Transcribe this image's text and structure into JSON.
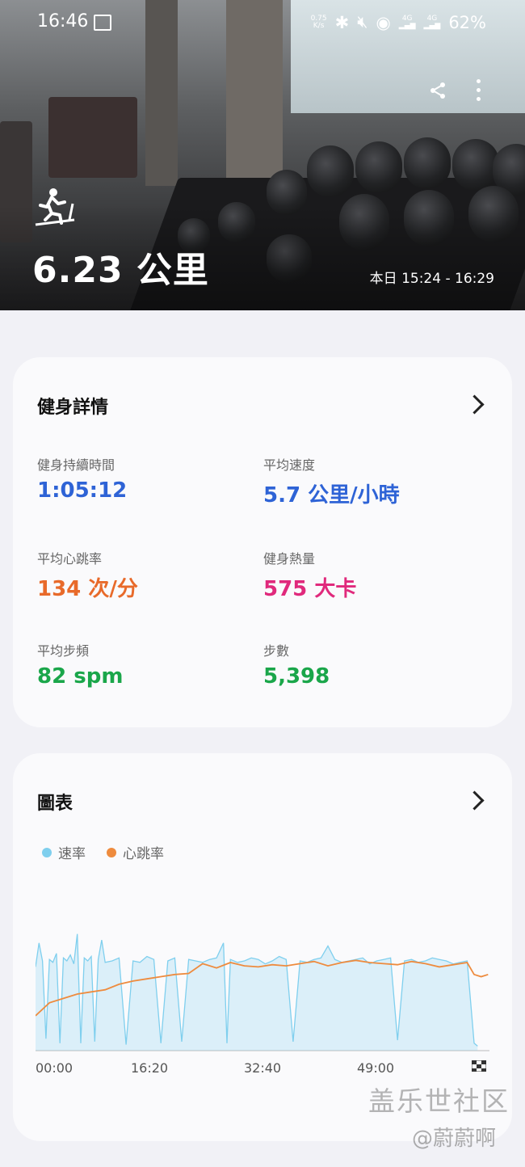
{
  "status_bar": {
    "time": "16:46",
    "net_speed_top": "0.75",
    "net_speed_bottom": "K/s",
    "signal1": "4G",
    "signal2": "4G",
    "battery": "62%"
  },
  "hero": {
    "distance": "6.23 公里",
    "time_range": "本日 15:24 - 16:29"
  },
  "details": {
    "title": "健身詳情",
    "metrics": [
      {
        "label": "健身持續時間",
        "value": "1:05:12",
        "color": "#2e63d6"
      },
      {
        "label": "平均速度",
        "value": "5.7 公里/小時",
        "color": "#2e63d6"
      },
      {
        "label": "平均心跳率",
        "value": "134 次/分",
        "color": "#e86a2a"
      },
      {
        "label": "健身熱量",
        "value": "575 大卡",
        "color": "#e0297c"
      },
      {
        "label": "平均步頻",
        "value": "82 spm",
        "color": "#1aa64a"
      },
      {
        "label": "步數",
        "value": "5,398",
        "color": "#1aa64a"
      }
    ]
  },
  "chart_card": {
    "title": "圖表",
    "legend": [
      {
        "label": "速率",
        "color": "#7fcfee"
      },
      {
        "label": "心跳率",
        "color": "#ee8b3e"
      }
    ],
    "x_ticks": [
      "00:00",
      "16:20",
      "32:40",
      "49:00"
    ]
  },
  "watermark": {
    "line1": "盖乐世社区",
    "line2": "@蔚蔚啊"
  },
  "chart_data": {
    "type": "line",
    "x_unit": "minutes",
    "xlim": [
      0,
      65.2
    ],
    "x_ticks": [
      "00:00",
      "16:20",
      "32:40",
      "49:00"
    ],
    "series": [
      {
        "name": "速率",
        "color": "#7fcfee",
        "fill": true,
        "x": [
          0,
          0.5,
          1,
          1.5,
          2,
          2.5,
          3,
          3.5,
          4,
          4.5,
          5,
          5.5,
          6,
          6.5,
          7,
          7.5,
          8,
          8.5,
          9,
          9.5,
          10,
          11,
          12,
          13,
          14,
          15,
          16,
          17,
          18,
          19,
          20,
          21,
          22,
          23,
          24,
          25,
          26,
          27,
          27.5,
          28,
          29,
          30,
          31,
          32,
          33,
          34,
          35,
          36,
          37,
          38,
          39,
          40,
          41,
          42,
          43,
          44,
          45,
          46,
          47,
          48,
          49,
          50,
          51,
          52,
          53,
          54,
          55,
          56,
          57,
          58,
          59,
          60,
          61,
          62,
          63,
          63.5
        ],
        "values": [
          5.6,
          7.2,
          6.0,
          0.8,
          6.1,
          5.9,
          6.5,
          0.5,
          6.2,
          6.0,
          6.4,
          5.8,
          7.8,
          0.5,
          6.2,
          6.0,
          6.3,
          0.6,
          6.1,
          7.4,
          5.9,
          6.0,
          6.2,
          0.4,
          6.0,
          5.9,
          6.3,
          6.1,
          0.5,
          6.0,
          6.2,
          0.6,
          6.1,
          6.0,
          5.9,
          6.1,
          6.2,
          7.2,
          0.5,
          6.1,
          5.9,
          6.0,
          6.2,
          6.1,
          5.8,
          6.0,
          6.3,
          6.1,
          0.6,
          6.0,
          5.9,
          6.1,
          6.2,
          7.0,
          6.1,
          5.9,
          6.0,
          6.1,
          6.2,
          5.8,
          6.0,
          6.1,
          6.2,
          0.7,
          6.0,
          6.1,
          5.9,
          6.0,
          6.2,
          6.1,
          6.0,
          5.8,
          5.9,
          6.0,
          0.5,
          0.3
        ],
        "ylim": [
          0,
          8
        ]
      },
      {
        "name": "心跳率",
        "color": "#ee8b3e",
        "fill": false,
        "x": [
          0,
          2,
          4,
          6,
          8,
          10,
          12,
          14,
          16,
          18,
          20,
          22,
          24,
          26,
          28,
          30,
          32,
          34,
          36,
          38,
          40,
          42,
          44,
          46,
          48,
          50,
          52,
          54,
          56,
          58,
          60,
          62,
          63,
          64,
          65
        ],
        "values": [
          92,
          104,
          108,
          112,
          114,
          116,
          121,
          124,
          126,
          128,
          130,
          131,
          140,
          136,
          141,
          138,
          137,
          139,
          138,
          140,
          142,
          138,
          141,
          143,
          141,
          140,
          139,
          142,
          140,
          137,
          139,
          141,
          130,
          128,
          130
        ],
        "ylim": [
          60,
          170
        ]
      }
    ]
  }
}
